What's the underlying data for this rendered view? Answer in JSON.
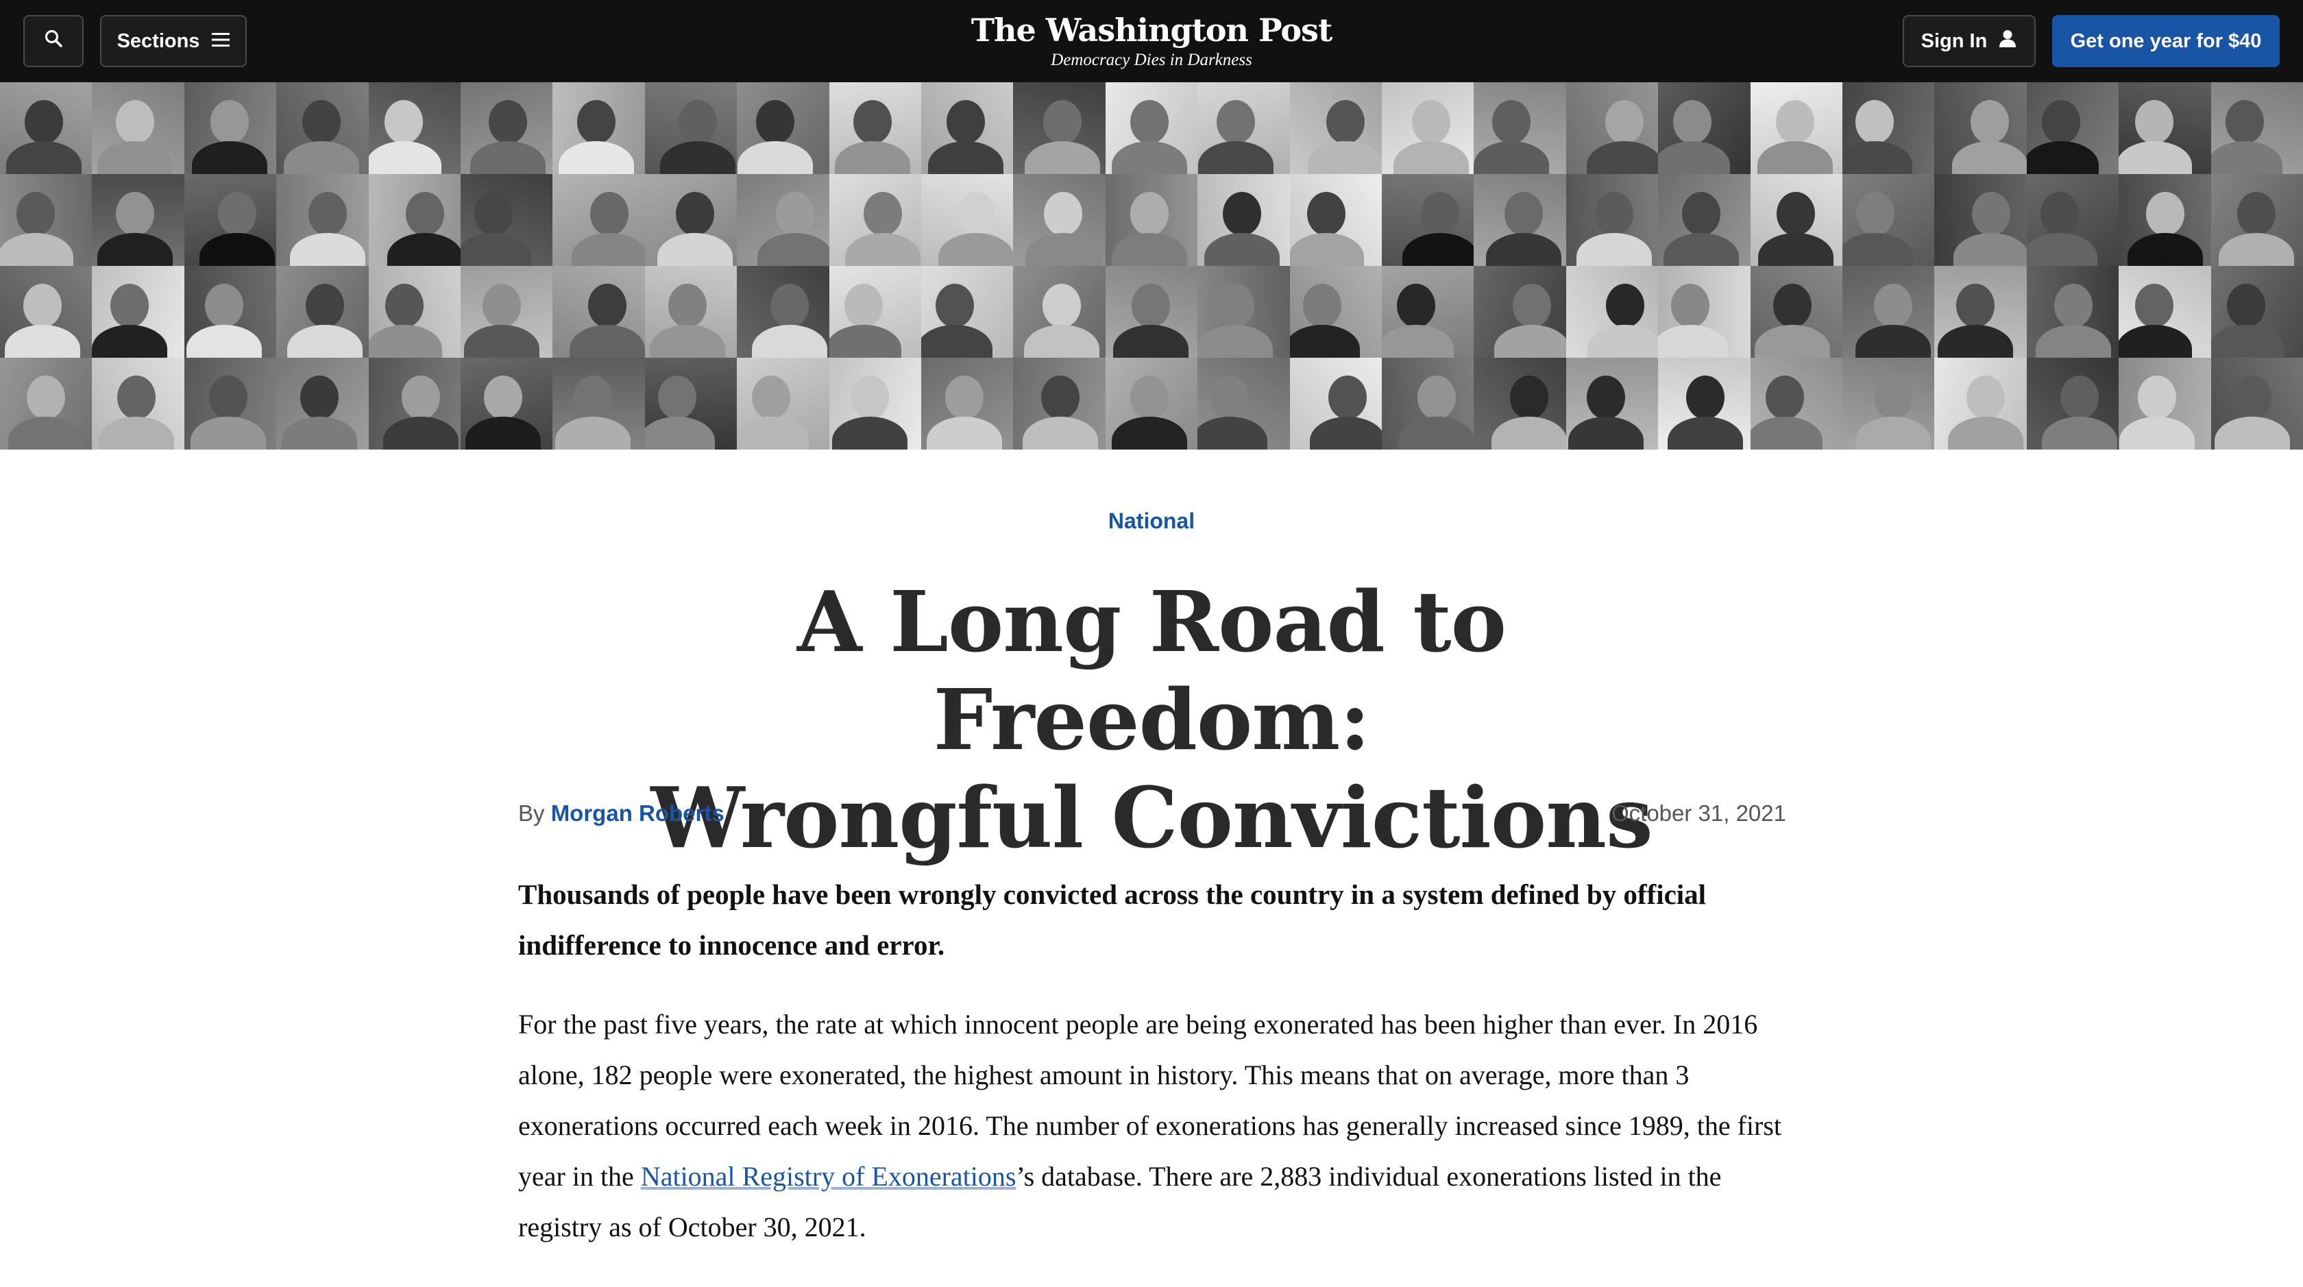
{
  "header": {
    "search_icon": "search-icon",
    "sections_label": "Sections",
    "sections_icon": "hamburger-menu-icon",
    "logo_text": "The Washington Post",
    "tagline": "Democracy Dies in Darkness",
    "signin_label": "Sign In",
    "signin_icon": "user-icon",
    "subscribe_label": "Get one year for $40",
    "colors": {
      "bar": "#111111",
      "subscribe": "#1955a5",
      "link": "#1955a5"
    }
  },
  "hero": {
    "description_kind": "grayscale-portrait-mosaic",
    "rows": 4,
    "columns": 25
  },
  "article": {
    "section": "National",
    "title_line1": "A Long Road to Freedom:",
    "title_line2": "Wrongful Convictions",
    "byline_prefix": "By",
    "author": "Morgan Roberts",
    "date": "October 31, 2021",
    "dek": "Thousands of people have been wrongly convicted across the country in a system defined by official indifference to innocence and error.",
    "para1_before": "For the past five years, the rate at which innocent people are being exonerated has been higher than ever. In 2016 alone, 182 people were exonerated, the highest amount in history. This means that on average, more than 3 exonerations occurred each week in 2016. The number of exonerations has generally increased since 1989, the first year in the ",
    "para1_link": "National Registry of Exonerations",
    "para1_after": "’s database. There are 2,883 individual exonerations listed in the registry as of October 30, 2021."
  }
}
